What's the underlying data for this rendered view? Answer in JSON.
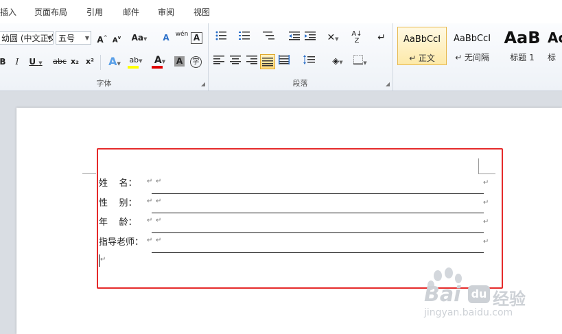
{
  "tabs": [
    "插入",
    "页面布局",
    "引用",
    "邮件",
    "审阅",
    "视图"
  ],
  "font_group": {
    "title": "字体",
    "font_name": "幼圆 (中文正文",
    "font_size": "五号",
    "buttons": {
      "grow": "A",
      "shrink": "A",
      "change_case": "Aa",
      "clear_format": "A",
      "phonetic": "wén",
      "char_border": "A",
      "bold": "B",
      "italic": "I",
      "underline": "U",
      "strike": "abc",
      "subscript": "x₂",
      "superscript": "x²",
      "text_effect": "A",
      "highlight": "ab",
      "font_color": "A",
      "char_shading": "A",
      "enclose": "字"
    }
  },
  "paragraph_group": {
    "title": "段落"
  },
  "styles": [
    {
      "sample": "AaBbCcI",
      "label": "↵ 正文"
    },
    {
      "sample": "AaBbCcI",
      "label": "↵ 无间隔"
    },
    {
      "sample": "AaB",
      "label": "标题 1"
    },
    {
      "sample": "Ac",
      "label": "标"
    }
  ],
  "document": {
    "fields": [
      {
        "label": "姓    名："
      },
      {
        "label": "性    别："
      },
      {
        "label": "年    龄："
      },
      {
        "label": "指导老师："
      }
    ],
    "para_mark": "↵"
  },
  "watermark": {
    "brand": "Bai",
    "brand2": "经验",
    "url": "jingyan.baidu.com"
  },
  "colors": {
    "highlight_box": "#e52a2a",
    "style_selected": "#fde9a8",
    "font_color_bar": "#e00000",
    "highlight_bar": "#ffff00"
  }
}
